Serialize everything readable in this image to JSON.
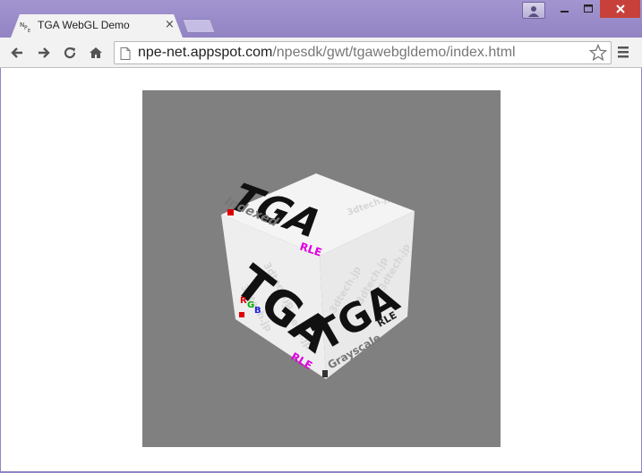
{
  "tab": {
    "title": "TGA WebGL Demo",
    "favicon_text": "NPE",
    "close_glyph": "×"
  },
  "address_bar": {
    "url_host": "npe-net.appspot.com",
    "url_path": "/npesdk/gwt/tgawebgldemo/index.html"
  },
  "cube": {
    "top_face": {
      "big_text": "TGA",
      "sub_text": "Indexed",
      "tag": "RLE"
    },
    "left_face": {
      "big_text": "TGA",
      "rgb": [
        "R",
        "G",
        "B"
      ],
      "tag": "RLE"
    },
    "right_face": {
      "big_text": "TGA",
      "sub_text": "Grayscale",
      "tag": "RLE"
    },
    "watermark": "3dtech.jp"
  },
  "colors": {
    "window_frame": "#9a8cc8",
    "close_button": "#c7413a",
    "canvas_bg": "#808080",
    "rle_magenta": "#e000e0"
  },
  "icons": [
    "back-arrow-icon",
    "forward-arrow-icon",
    "reload-icon",
    "home-icon",
    "page-icon",
    "star-icon",
    "menu-icon",
    "profile-icon",
    "minimize-icon",
    "maximize-icon",
    "close-icon"
  ]
}
